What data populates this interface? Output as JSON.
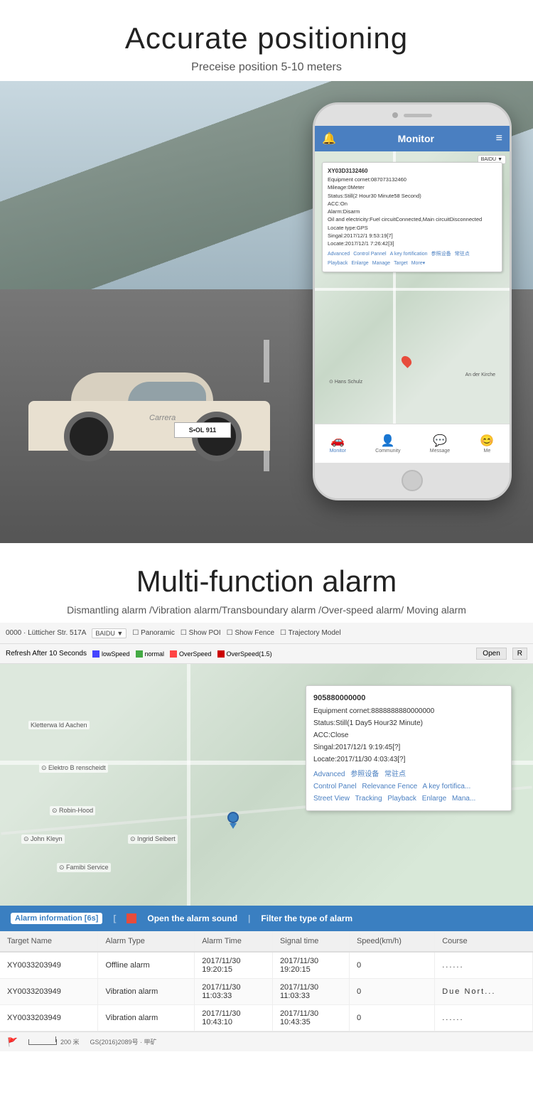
{
  "section1": {
    "title": "Accurate positioning",
    "subtitle": "Preceise position 5-10 meters"
  },
  "phone": {
    "header": {
      "title": "Monitor",
      "bell_icon": "🔔",
      "menu_icon": "≡"
    },
    "map_info": {
      "device_id": "XY03D3132460",
      "equipment_cornet": "Equipment cornet:087073132460",
      "mileage": "Mileage:0Meter",
      "status": "Status:Still(2 Hour30 Minute58 Second)",
      "acc": "ACC:On",
      "alarm": "Alarm:Disarm",
      "oil": "Oil and electricity:Fuel circuitConnected,Main circuitDisconnected",
      "locate_type": "Locate type:GPS",
      "singal": "Singal:2017/12/1 9:53:19[7]",
      "locate": "Locate:2017/12/1 7:26:42[3]",
      "links": {
        "advanced": "Advanced",
        "control": "Control Pannel",
        "fortification": "A key fortification",
        "device": "参照设备",
        "parking": "常驻点",
        "playback": "Playback",
        "enlarge": "Enlarge",
        "manage": "Manage",
        "target": "Target",
        "more": "More▾"
      }
    },
    "nav": {
      "monitor": "Monitor",
      "community": "Community",
      "message": "Message",
      "me": "Me"
    },
    "baidu_label": "BAIDU",
    "hans_label": "Hans Schulz",
    "kirche_label": "An der Kirche"
  },
  "section2": {
    "title": "Multi-function alarm",
    "subtitle": "Dismantling alarm /Vibration alarm/Transboundary alarm /Over-speed alarm/ Moving alarm"
  },
  "map_toolbar": {
    "address": "0000 · Lütticher Str. 517A",
    "dropdown": "BAIDU",
    "panoramic": "Panoramic",
    "show_poi": "Show POI",
    "show_fence": "Show Fence",
    "trajectory_model": "Trajectory Model"
  },
  "speed_legend": {
    "refresh": "Refresh After 10 Seconds",
    "low": "lowSpeed",
    "normal": "normal",
    "overspeed": "OverSpeed",
    "overspeed15": "OverSpeed(1.5)",
    "open_btn": "Open",
    "r_btn": "R"
  },
  "info_popup": {
    "device_id": "905880000000",
    "equipment_cornet": "Equipment cornet:8888888880000000",
    "status": "Status:Still(1 Day5 Hour32 Minute)",
    "acc": "ACC:Close",
    "singal": "Singal:2017/12/1 9:19:45[?]",
    "locate": "Locate:2017/11/30 4:03:43[?]",
    "links": {
      "advanced": "Advanced",
      "reference": "参照设备",
      "parking": "常驻点",
      "control": "Control Panel",
      "relevance_fence": "Relevance Fence",
      "fortification": "A key fortifica...",
      "street_view": "Street View",
      "tracking": "Tracking",
      "playback": "Playback",
      "enlarge": "Enlarge",
      "manage": "Mana..."
    }
  },
  "map_labels": {
    "kletterwa": "Kletterwa ld Aachen",
    "elektro": "Elektro B renscheidt",
    "robin": "Robin-Hood",
    "john": "John Kleyn",
    "ingrid": "Ingrid Seibert",
    "famibi": "Famibi Service"
  },
  "alarm_bar": {
    "label": "Alarm information [6s]",
    "open_sound": "Open the alarm sound",
    "filter": "Filter the type of alarm",
    "separator": "|"
  },
  "alarm_table": {
    "headers": [
      "Target Name",
      "Alarm Type",
      "Alarm Time",
      "Signal time",
      "Speed(km/h)",
      "Course"
    ],
    "rows": [
      {
        "target": "XY0033203949",
        "alarm_type": "Offline alarm",
        "alarm_time": "2017/11/30\n19:20:15",
        "signal_time": "2017/11/30\n19:20:15",
        "speed": "0",
        "course": "......"
      },
      {
        "target": "XY0033203949",
        "alarm_type": "Vibration alarm",
        "alarm_time": "2017/11/30\n11:03:33",
        "signal_time": "2017/11/30\n11:03:33",
        "speed": "0",
        "course": "Due Nort..."
      },
      {
        "target": "XY0033203949",
        "alarm_type": "Vibration alarm",
        "alarm_time": "2017/11/30\n10:43:10",
        "signal_time": "2017/11/30\n10:43:35",
        "speed": "0",
        "course": "......"
      }
    ]
  },
  "footer": {
    "scale": "200 米",
    "gs_label": "GS(2016)2089号 · 甲矿",
    "red_flag": "🚩"
  },
  "car": {
    "license_plate": "S•OL 911",
    "logo": "Carrera"
  }
}
